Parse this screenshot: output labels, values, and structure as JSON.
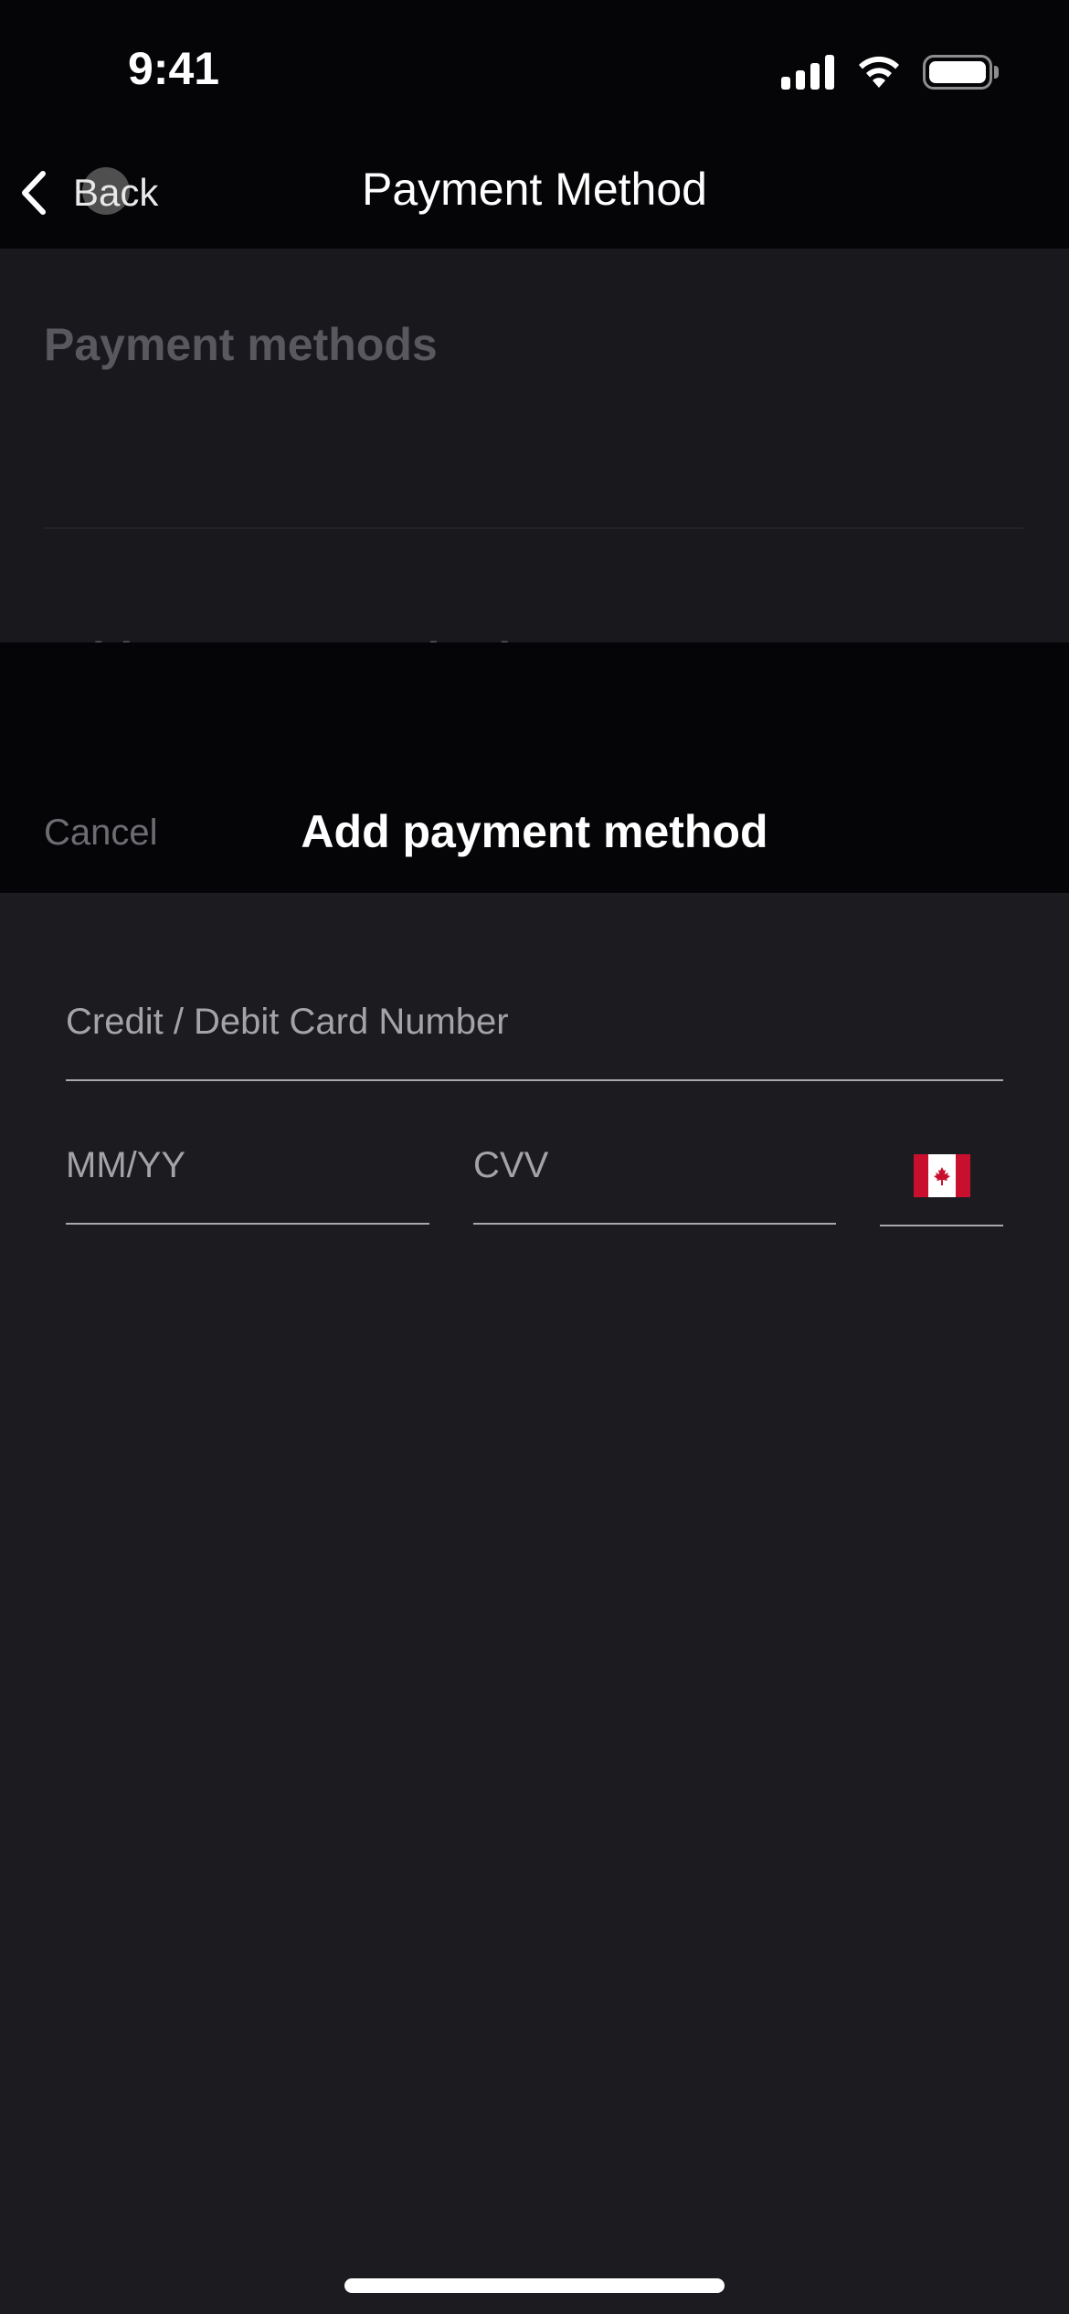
{
  "status_bar": {
    "time": "9:41",
    "icons": [
      "cellular-signal-icon",
      "wifi-icon",
      "battery-icon"
    ]
  },
  "nav_bar": {
    "back_label": "Back",
    "back_icon": "chevron-left-icon",
    "title": "Payment Method"
  },
  "background_page": {
    "section_title": "Payment methods",
    "partial_row_label": "Add payment method"
  },
  "sheet": {
    "cancel_label": "Cancel",
    "title": "Add payment method",
    "fields": {
      "card_number": {
        "value": "",
        "placeholder": "Credit / Debit Card Number"
      },
      "expiry": {
        "value": "",
        "placeholder": "MM/YY"
      },
      "cvv": {
        "value": "",
        "placeholder": "CVV"
      },
      "country": {
        "selected": "Canada",
        "icon": "canada-flag-icon"
      }
    }
  },
  "colors": {
    "background": "#1c1b20",
    "header": "#050407",
    "placeholder": "#a4a3a8",
    "underline": "#a9a8ad",
    "flag_red": "#c8102e"
  }
}
